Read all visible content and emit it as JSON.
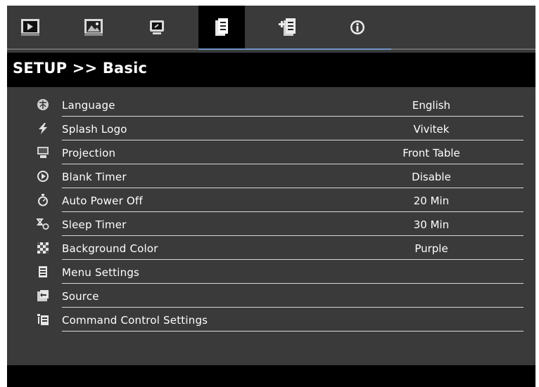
{
  "header": {
    "title": "SETUP >> Basic"
  },
  "tabs": [
    {
      "id": "picture",
      "icon": "play-screen-icon"
    },
    {
      "id": "image",
      "icon": "picture-icon"
    },
    {
      "id": "display",
      "icon": "monitor-icon"
    },
    {
      "id": "setup-basic",
      "icon": "document-icon",
      "active": true
    },
    {
      "id": "setup-advanced",
      "icon": "document-plus-icon"
    },
    {
      "id": "info",
      "icon": "info-icon"
    }
  ],
  "menu": {
    "items": [
      {
        "label": "Language",
        "value": "English",
        "icon": "language-icon"
      },
      {
        "label": "Splash Logo",
        "value": "Vivitek",
        "icon": "lightning-icon"
      },
      {
        "label": "Projection",
        "value": "Front Table",
        "icon": "projection-icon"
      },
      {
        "label": "Blank Timer",
        "value": "Disable",
        "icon": "play-circle-icon"
      },
      {
        "label": "Auto Power Off",
        "value": "20 Min",
        "icon": "stopwatch-icon"
      },
      {
        "label": "Sleep Timer",
        "value": "30 Min",
        "icon": "sleep-icon"
      },
      {
        "label": "Background Color",
        "value": "Purple",
        "icon": "checker-icon"
      },
      {
        "label": "Menu Settings",
        "value": "",
        "icon": "menu-icon"
      },
      {
        "label": "Source",
        "value": "",
        "icon": "source-icon"
      },
      {
        "label": "Command Control Settings",
        "value": "",
        "icon": "command-icon"
      }
    ]
  },
  "colors": {
    "osd_bg": "#3a3a3a",
    "header_bg": "#000000",
    "accent": "#6f97c6",
    "text": "#ffffff"
  }
}
